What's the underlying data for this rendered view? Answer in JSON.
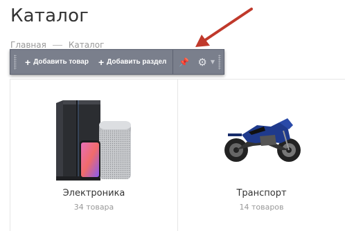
{
  "page": {
    "title": "Каталог"
  },
  "breadcrumb": {
    "items": [
      "Главная",
      "Каталог"
    ]
  },
  "admin_panel": {
    "add_product_label": "Добавить товар",
    "add_section_label": "Добавить раздел",
    "icons": [
      "pin-icon",
      "gear-icon",
      "caret-down-icon"
    ]
  },
  "annotation": {
    "color": "#c0392b"
  },
  "categories": [
    {
      "name": "Электроника",
      "count": "34 товара"
    },
    {
      "name": "Транспорт",
      "count": "14 товаров"
    }
  ]
}
